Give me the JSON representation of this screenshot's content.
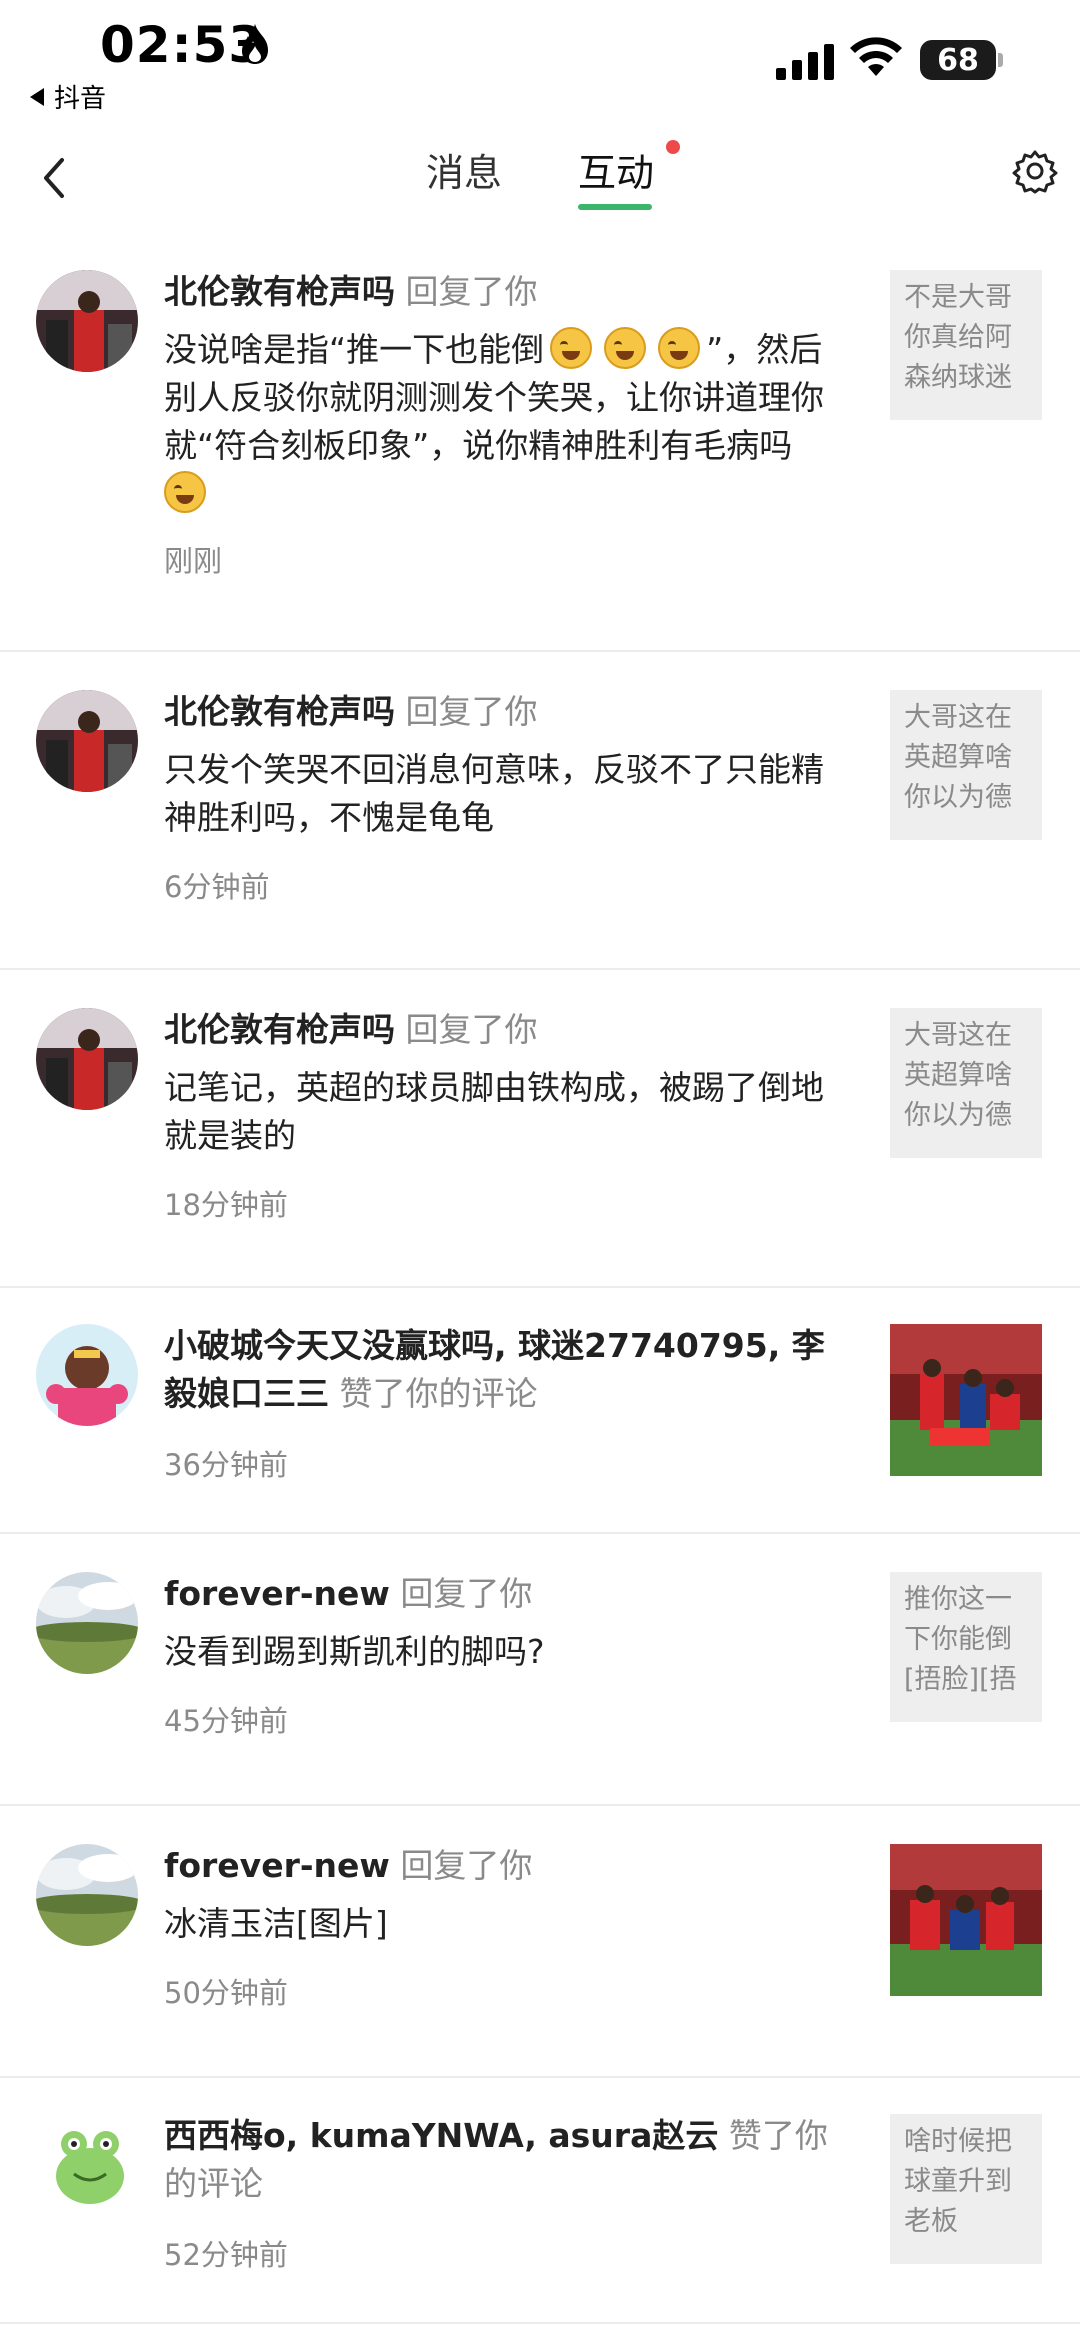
{
  "status_bar": {
    "time": "02:53",
    "back_app_label": "抖音",
    "battery": "68"
  },
  "header": {
    "tabs": [
      {
        "label": "消息",
        "active": false
      },
      {
        "label": "互动",
        "active": true,
        "has_dot": true
      }
    ]
  },
  "colors": {
    "accent_green": "#3bb56a",
    "notification_dot": "#ee4a4a",
    "secondary_text": "#8a8a8a"
  },
  "items": [
    {
      "name": "北伦敦有枪声吗",
      "action": "回复了你",
      "text_a": "没说啥是指“推一下也能倒",
      "text_b": "”，然后别人反驳你就阴测测发个笑哭，让你讲道理你就“符合刻板印象”，说你精神胜利有毛病吗",
      "time": "刚刚",
      "quote": "不是大哥你真给阿森纳球迷"
    },
    {
      "name": "北伦敦有枪声吗",
      "action": "回复了你",
      "text": "只发个笑哭不回消息何意味，反驳不了只能精神胜利吗，不愧是龟龟",
      "time": "6分钟前",
      "quote": "大哥这在英超算啥你以为德"
    },
    {
      "name": "北伦敦有枪声吗",
      "action": "回复了你",
      "text": "记笔记，英超的球员脚由铁构成，被踢了倒地就是装的",
      "time": "18分钟前",
      "quote": "大哥这在英超算啥你以为德"
    },
    {
      "name": "小破城今天又没赢球吗, 球迷27740795, 李毅娘口三三",
      "action": "赞了你的评论",
      "time": "36分钟前"
    },
    {
      "name": "forever-new",
      "action": "回复了你",
      "text": "没看到踢到斯凯利的脚吗?",
      "time": "45分钟前",
      "quote": "推你这一下你能倒[捂脸][捂"
    },
    {
      "name": "forever-new",
      "action": "回复了你",
      "text": "冰清玉洁[图片]",
      "time": "50分钟前"
    },
    {
      "name": "西西梅o, kumaYNWA, asura赵云",
      "action": "赞了你的评论",
      "time": "52分钟前",
      "quote": "啥时候把球童升到老板"
    }
  ]
}
